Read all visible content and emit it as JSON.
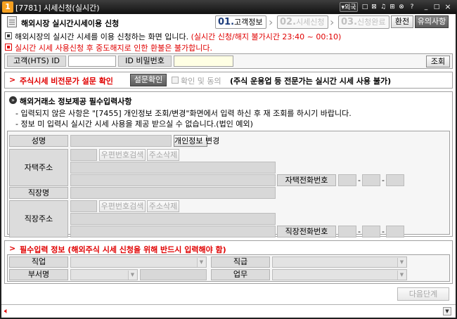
{
  "window": {
    "app_icon": "1",
    "title": "[7781] 시세신청(실시간)",
    "controls": [
      "▾외국",
      "□",
      "⊠",
      "♫",
      "⊞",
      "⊗",
      "?",
      "_",
      "□",
      "×"
    ]
  },
  "header": {
    "title": "해외시장 실시간시세이용 신청",
    "steps": [
      {
        "num": "01.",
        "label": "고객정보"
      },
      {
        "num": "02.",
        "label": "시세신청"
      },
      {
        "num": "03.",
        "label": "신청완료"
      }
    ],
    "btn_switch": "환전",
    "btn_notice": "유의사항"
  },
  "notices": {
    "line1_prefix": "해외시장의 실시간 시세를 이용 신청하는 화면 입니다.",
    "line1_red": "(실시간 신청/해지 불가시간 23:40 ~ 00:10)",
    "line2": "실시간 시세 사용신청 후 중도해지로 인한 환불은 불가합니다."
  },
  "login": {
    "account_label": "고객(HTS) ID",
    "account_value": "",
    "password_label": "ID 비밀번호",
    "password_value": "",
    "query_button": "조회"
  },
  "survey": {
    "arrow": ">",
    "title": "주식시세 비전문가 설문 확인",
    "confirm_button": "설문확인",
    "agree_label": "확인 및 동의",
    "note": "(주식 운용업 등 전문가는 실시간 시세 사용 불가)"
  },
  "required": {
    "title": "해외거래소 정보제공 필수입력사항",
    "bullet1": "- 입력되지 않은 사항은 \"[7455] 개인정보 조회/변경\"화면에서 입력 하신 후 재 조회를 하시기 바랍니다.",
    "bullet2": "- 정보 미 입력시 실시간 시세 사용을 제공 받으실 수 없습니다.(법인 예외)"
  },
  "personal": {
    "name_label": "성명",
    "change_info_button": "개인정보 변경",
    "home_addr_label": "자택주소",
    "postcode_button": "우편번호검색",
    "addr_delete_button": "주소삭제",
    "home_phone_label": "자택전화번호",
    "company_label": "직장명",
    "work_addr_label": "직장주소",
    "work_phone_label": "직장전화번호",
    "phone_sep": "-"
  },
  "mandatory": {
    "arrow": ">",
    "title": "필수입력 정보 (해외주식 시세 신청을 위해 반드시 입력해야 함)",
    "job_label": "직업",
    "rank_label": "직급",
    "dept_label": "부서명",
    "duty_label": "업무"
  },
  "footer": {
    "next_button": "다음단계",
    "speaker_icon": "speaker-icon"
  }
}
